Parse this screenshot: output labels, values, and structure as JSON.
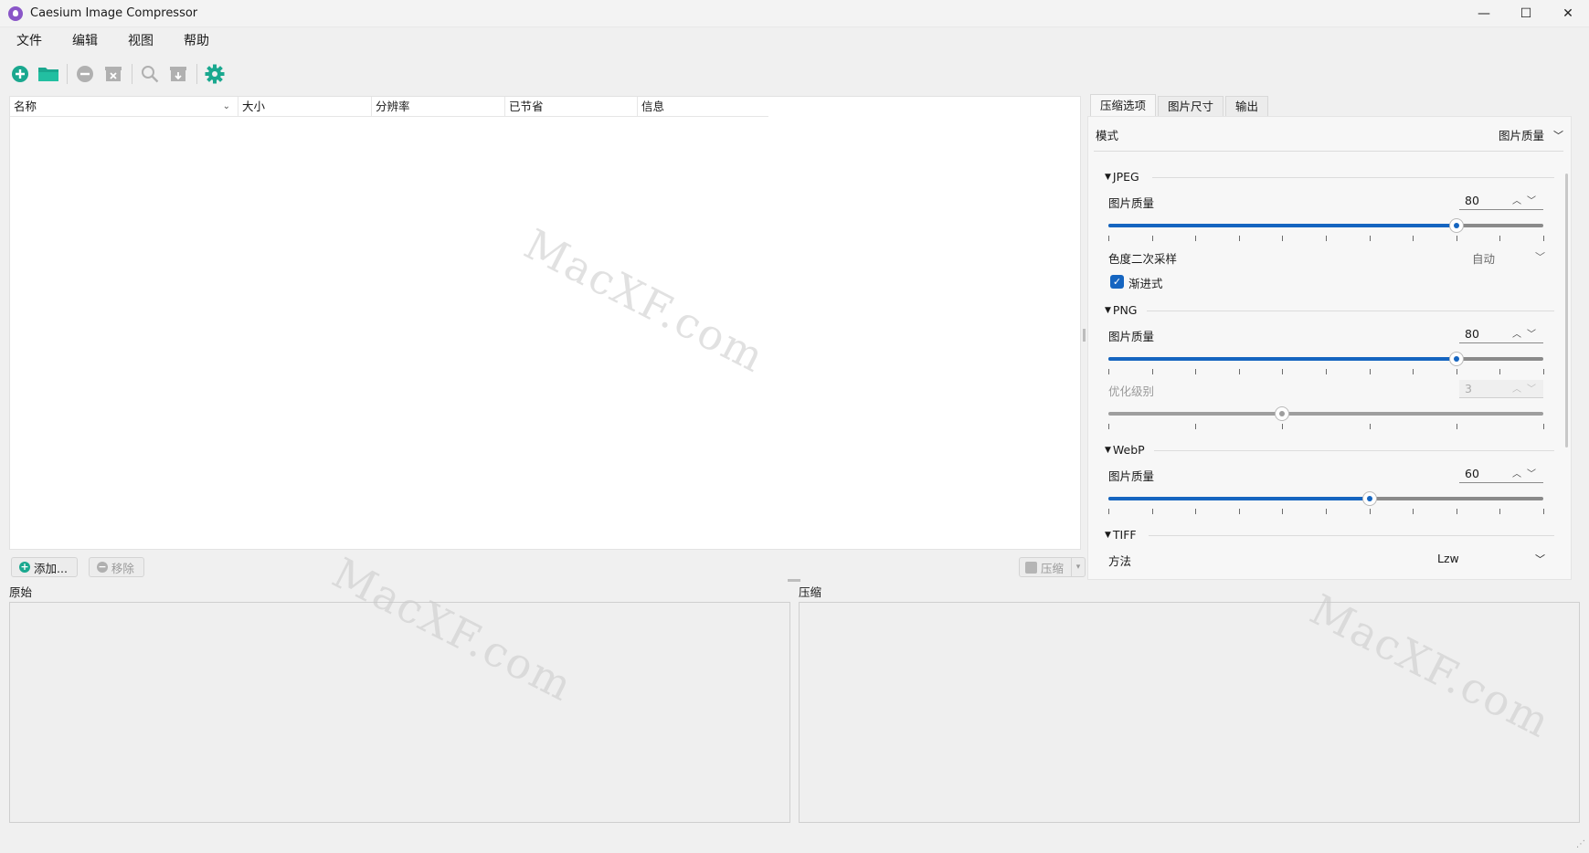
{
  "window": {
    "title": "Caesium Image Compressor",
    "controls": {
      "minimize": "—",
      "maximize": "☐",
      "close": "✕"
    }
  },
  "menu": [
    "文件",
    "编辑",
    "视图",
    "帮助"
  ],
  "toolbar": {
    "icons": [
      "add-file-icon",
      "open-folder-icon",
      "remove-icon",
      "clear-list-icon",
      "search-icon",
      "import-icon",
      "settings-icon"
    ],
    "accent_color": "#1aa88f"
  },
  "table": {
    "columns": [
      "名称",
      "大小",
      "分辨率",
      "已节省",
      "信息"
    ],
    "sort_indicator": "⌄"
  },
  "actions": {
    "add_label": "添加...",
    "remove_label": "移除",
    "compress_label": "压缩",
    "dropdown_arrow": "▾"
  },
  "preview": {
    "original_label": "原始",
    "compressed_label": "压缩"
  },
  "options": {
    "tabs": [
      "压缩选项",
      "图片尺寸",
      "输出"
    ],
    "mode_label": "模式",
    "mode_value": "图片质量",
    "jpeg": {
      "title": "JPEG",
      "quality_label": "图片质量",
      "quality_value": "80",
      "chroma_label": "色度二次采样",
      "chroma_value": "自动",
      "progressive_label": "渐进式",
      "progressive_checked": true
    },
    "png": {
      "title": "PNG",
      "quality_label": "图片质量",
      "quality_value": "80",
      "optimization_label": "优化级别",
      "optimization_value": "3"
    },
    "webp": {
      "title": "WebP",
      "quality_label": "图片质量",
      "quality_value": "60"
    },
    "tiff": {
      "title": "TIFF",
      "method_label": "方法",
      "method_value": "Lzw"
    },
    "slider_levels": {
      "jpeg_quality": 0.8,
      "png_quality": 0.8,
      "png_optimization": 0.4,
      "webp_quality": 0.6
    },
    "accent": "#1565c0"
  },
  "watermark": "MacXF.com"
}
